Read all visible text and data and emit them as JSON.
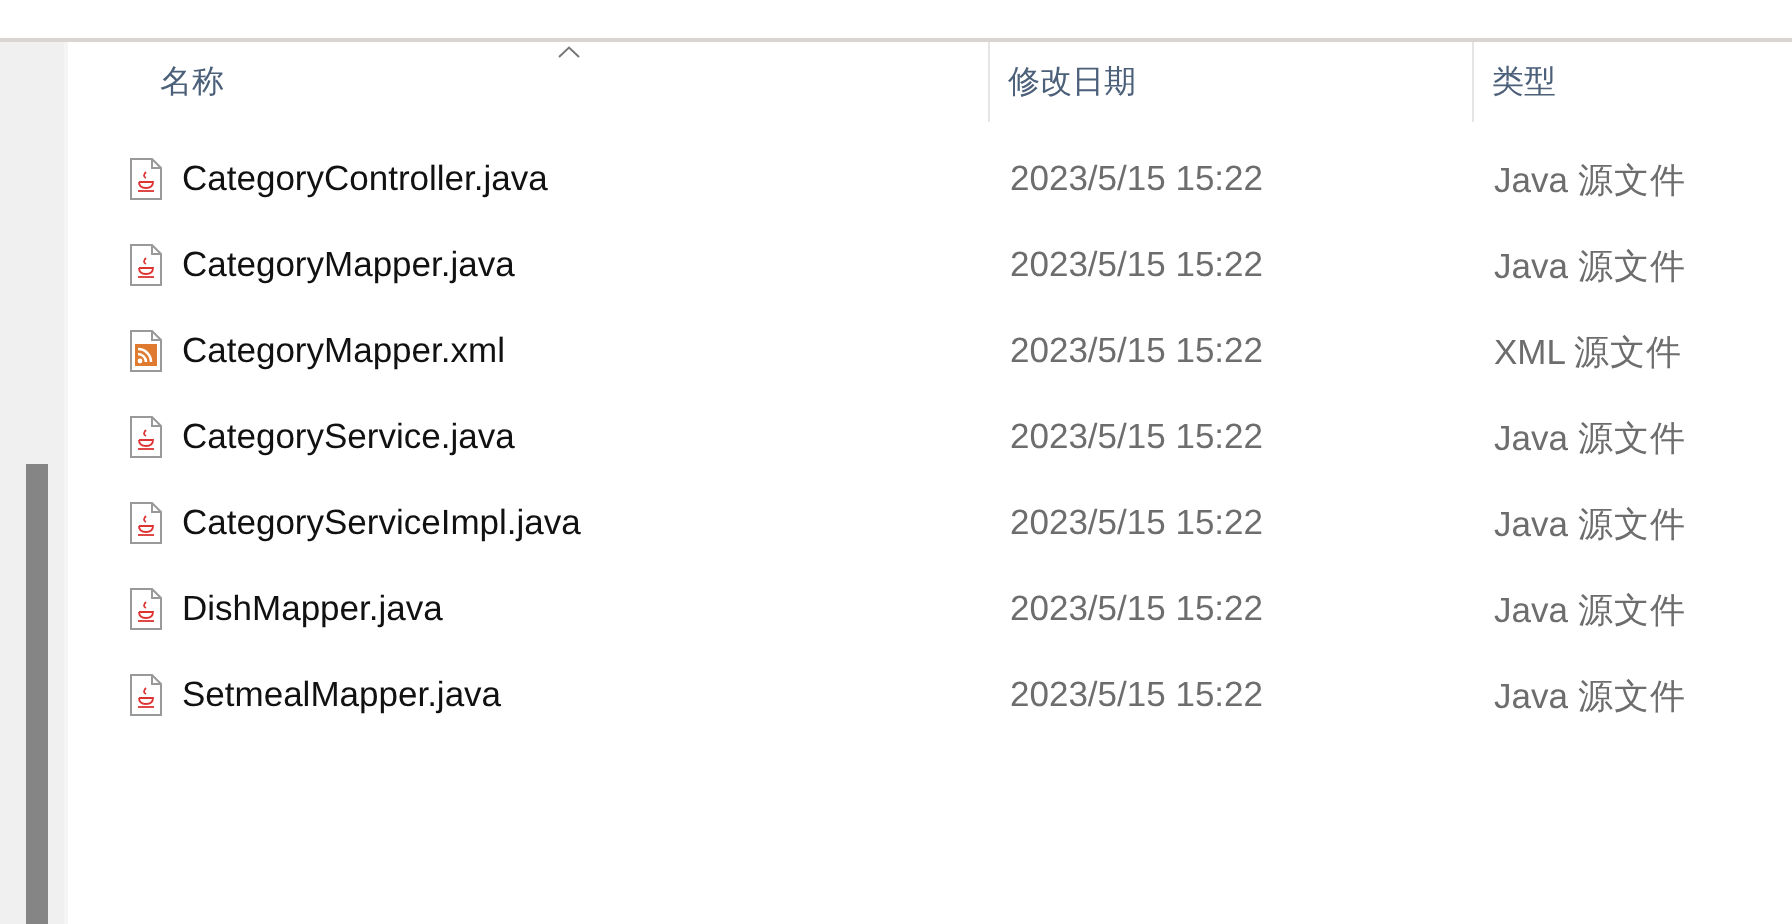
{
  "columns": [
    {
      "label": "名称",
      "sorted": true
    },
    {
      "label": "修改日期",
      "sorted": false
    },
    {
      "label": "类型",
      "sorted": false
    }
  ],
  "rows": [
    {
      "name": "CategoryController.java",
      "kind": "java",
      "date": "2023/5/15 15:22",
      "type": "Java 源文件"
    },
    {
      "name": "CategoryMapper.java",
      "kind": "java",
      "date": "2023/5/15 15:22",
      "type": "Java 源文件"
    },
    {
      "name": "CategoryMapper.xml",
      "kind": "xml",
      "date": "2023/5/15 15:22",
      "type": "XML 源文件"
    },
    {
      "name": "CategoryService.java",
      "kind": "java",
      "date": "2023/5/15 15:22",
      "type": "Java 源文件"
    },
    {
      "name": "CategoryServiceImpl.java",
      "kind": "java",
      "date": "2023/5/15 15:22",
      "type": "Java 源文件"
    },
    {
      "name": "DishMapper.java",
      "kind": "java",
      "date": "2023/5/15 15:22",
      "type": "Java 源文件"
    },
    {
      "name": "SetmealMapper.java",
      "kind": "java",
      "date": "2023/5/15 15:22",
      "type": "Java 源文件"
    }
  ]
}
